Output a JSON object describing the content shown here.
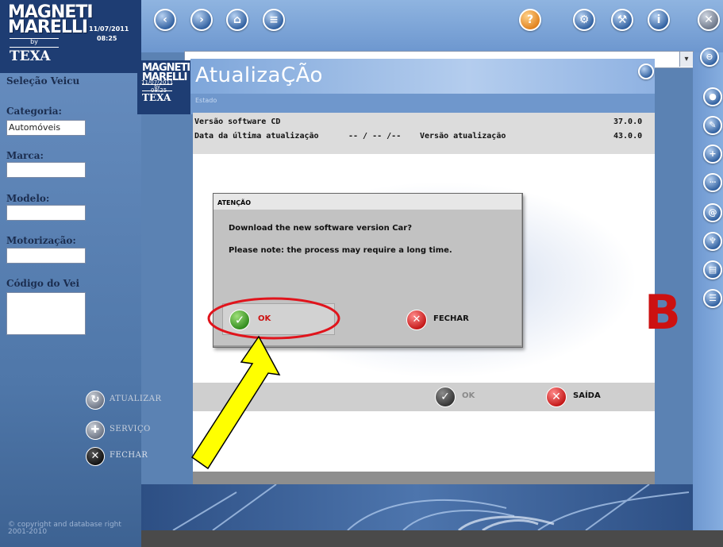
{
  "brand": {
    "line1": "MAGNETI",
    "line2": "MARELLI",
    "by": "by",
    "texa": "TEXA",
    "date": "11/07/2011",
    "time": "08:25"
  },
  "sidebar": {
    "header": "Seleção Veicu",
    "category_label": "Categoria:",
    "category_value": "Automóveis",
    "brand_label": "Marca:",
    "model_label": "Modelo:",
    "engine_label": "Motorização:",
    "vehicle_code_label": "Código do Vei",
    "buttons": [
      {
        "label": "ATUALIZAR",
        "icon": "update-icon"
      },
      {
        "label": "SERVIÇO",
        "icon": "service-icon"
      },
      {
        "label": "FECHAR",
        "icon": "close-icon"
      }
    ],
    "copyright": "© copyright and database right 2001-2010"
  },
  "window": {
    "title": "AtualizaÇÃo",
    "status": "Estado",
    "info": {
      "cd_version_label": "Versão software CD",
      "cd_version_value": "37.0.0",
      "last_update_label": "Data da última atualização",
      "last_update_value": "-- / -- /--",
      "update_version_label": "Versão atualização",
      "update_version_value": "43.0.0"
    },
    "ok_label": "OK",
    "exit_label": "SAÍDA",
    "partial_glyph": "B"
  },
  "dialog": {
    "title": "ATENÇÃO",
    "message1": "Download the new software version Car?",
    "message2": "Please note: the process may require a long time.",
    "ok_label": "OK",
    "close_label": "FECHAR"
  },
  "colors": {
    "highlight": "#e0141c",
    "arrow_fill": "#ffff00",
    "brand_blue": "#1e3d73"
  }
}
